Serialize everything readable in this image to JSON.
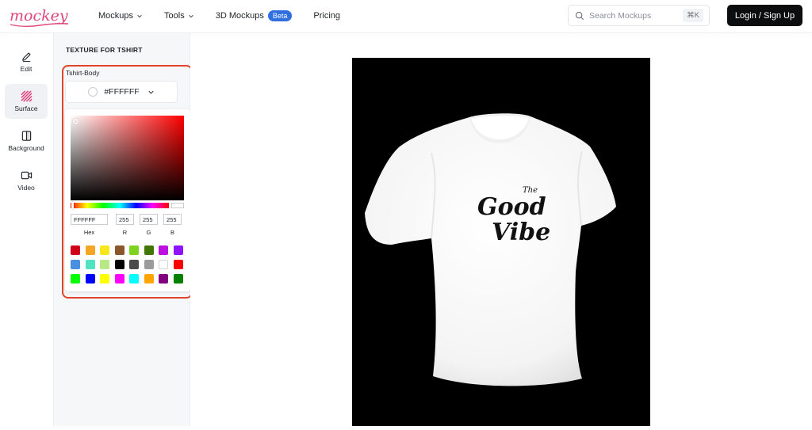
{
  "brand": {
    "name": "mockey",
    "color": "#e0457b"
  },
  "nav": {
    "items": [
      {
        "label": "Mockups",
        "dropdown": true
      },
      {
        "label": "Tools",
        "dropdown": true
      },
      {
        "label": "3D Mockups",
        "badge": "Beta"
      },
      {
        "label": "Pricing"
      }
    ]
  },
  "search": {
    "placeholder": "Search Mockups",
    "shortcut": "⌘K"
  },
  "auth": {
    "login_label": "Login / Sign Up"
  },
  "sidebar": {
    "items": [
      {
        "label": "Edit",
        "icon": "pencil-icon"
      },
      {
        "label": "Surface",
        "icon": "texture-icon",
        "active": true
      },
      {
        "label": "Background",
        "icon": "background-icon"
      },
      {
        "label": "Video",
        "icon": "video-icon"
      }
    ]
  },
  "panel": {
    "title": "TEXTURE FOR TSHIRT",
    "part_label": "Tshirt-Body",
    "selected_color": "#FFFFFF",
    "picker": {
      "hex": "FFFFFF",
      "r": "255",
      "g": "255",
      "b": "255",
      "labels": {
        "hex": "Hex",
        "r": "R",
        "g": "G",
        "b": "B"
      },
      "presets": [
        "#D0021B",
        "#F5A623",
        "#F8E71C",
        "#8B572A",
        "#7ED321",
        "#417505",
        "#BD10E0",
        "#9013FE",
        "#4A90E2",
        "#50E3C2",
        "#B8E986",
        "#000000",
        "#4A4A4A",
        "#9B9B9B",
        "#FFFFFF",
        "#FF0000",
        "#00FF00",
        "#0000FF",
        "#FFFF00",
        "#FF00FF",
        "#00FFFF",
        "#FFA500",
        "#800080",
        "#008000"
      ]
    }
  },
  "mockup": {
    "background": "#000000",
    "shirt_color": "#FFFFFF",
    "print_text": [
      "The",
      "Good",
      "Vibe"
    ]
  }
}
